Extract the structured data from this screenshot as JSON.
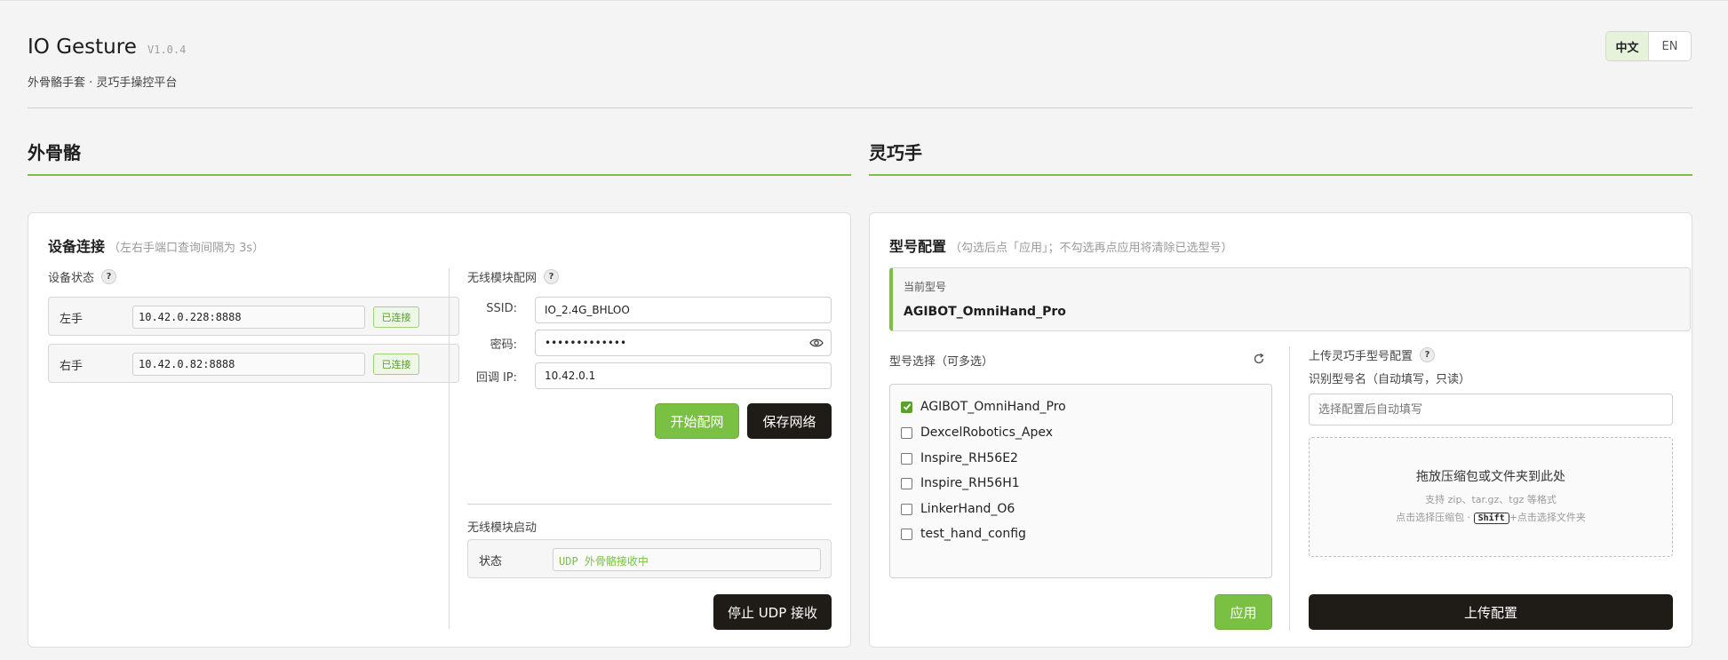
{
  "header": {
    "title": "IO Gesture",
    "version": "V1.0.4",
    "subtitle": "外骨骼手套 · 灵巧手操控平台",
    "lang": {
      "zh": "中文",
      "en": "EN"
    }
  },
  "sections": {
    "exo": "外骨骼",
    "hand": "灵巧手"
  },
  "device": {
    "title": "设备连接",
    "hint": "（左右手端口查询间隔为 3s）",
    "status_label": "设备状态",
    "help": "?",
    "left": {
      "name": "左手",
      "addr": "10.42.0.228:8888",
      "status": "已连接"
    },
    "right": {
      "name": "右手",
      "addr": "10.42.0.82:8888",
      "status": "已连接"
    }
  },
  "wifi": {
    "title": "无线模块配网",
    "ssid_label": "SSID:",
    "ssid_value": "IO_2.4G_BHLOO",
    "pwd_label": "密码:",
    "pwd_value": "•••••••••••••",
    "ip_label": "回调 IP:",
    "ip_value": "10.42.0.1",
    "start_btn": "开始配网",
    "save_btn": "保存网络"
  },
  "wireless_start": {
    "title": "无线模块启动",
    "status_label": "状态",
    "status_value": "UDP 外骨骼接收中",
    "stop_btn": "停止 UDP 接收"
  },
  "model_config": {
    "title": "型号配置",
    "hint": "（勾选后点「应用」；不勾选再点应用将清除已选型号）",
    "current_label": "当前型号",
    "current_value": "AGIBOT_OmniHand_Pro",
    "select_label": "型号选择（可多选）",
    "models": [
      {
        "name": "AGIBOT_OmniHand_Pro",
        "checked": true
      },
      {
        "name": "DexcelRobotics_Apex",
        "checked": false
      },
      {
        "name": "Inspire_RH56E2",
        "checked": false
      },
      {
        "name": "Inspire_RH56H1",
        "checked": false
      },
      {
        "name": "LinkerHand_O6",
        "checked": false
      },
      {
        "name": "test_hand_config",
        "checked": false
      }
    ],
    "apply_btn": "应用"
  },
  "upload": {
    "title": "上传灵巧手型号配置",
    "name_label": "识别型号名（自动填写，只读）",
    "name_placeholder": "选择配置后自动填写",
    "dz_main": "拖放压缩包或文件夹到此处",
    "dz_sub": "支持 zip、tar.gz、tgz 等格式",
    "dz_sub2_a": "点击选择压缩包 · ",
    "dz_key": "Shift",
    "dz_sub2_b": "+点击选择文件夹",
    "upload_btn": "上传配置"
  },
  "colors": {
    "accent": "#7ac143",
    "dark": "#1f1b16"
  }
}
